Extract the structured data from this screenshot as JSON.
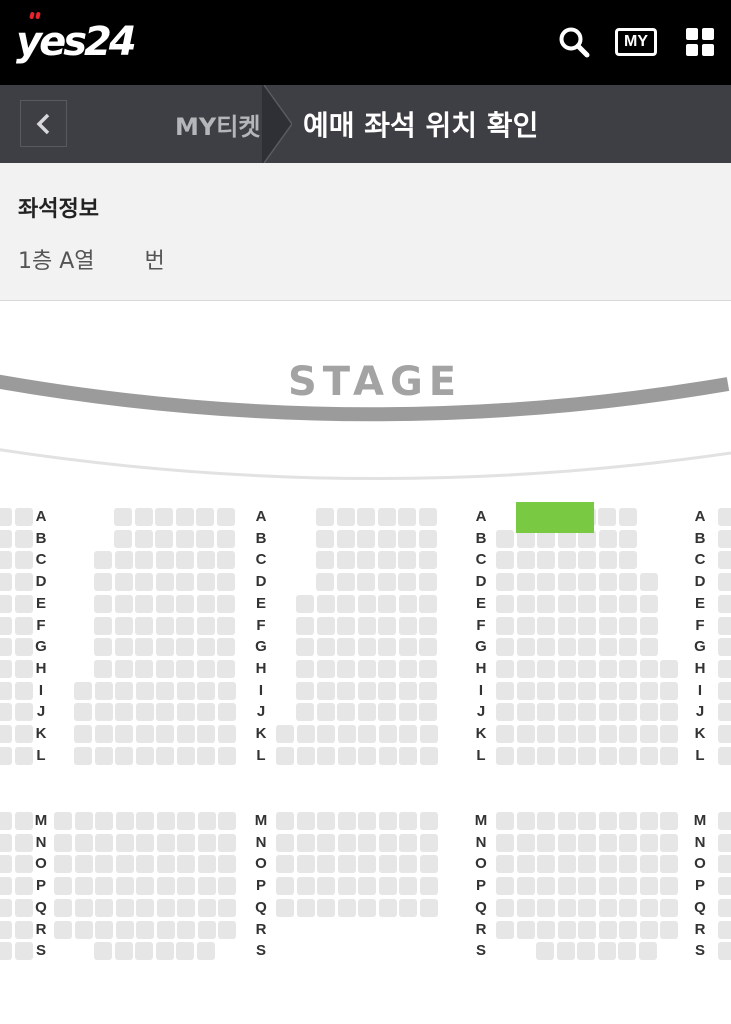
{
  "header": {
    "logo_text": "yes24",
    "my_button_label": "MY",
    "icons": [
      "search-icon",
      "my-ticket-icon",
      "grid-menu-icon"
    ],
    "colors": {
      "background": "#000000",
      "logo_dots": "#e8232b"
    }
  },
  "breadcrumb": {
    "parent": "MY티켓",
    "current": "예매 좌석 위치 확인",
    "back_icon": "chevron-left-icon"
  },
  "seat_info": {
    "title": "좌석정보",
    "floor_row": "1층 A열",
    "seat_suffix": "번"
  },
  "seatmap": {
    "stage_label": "STAGE",
    "block_row_labels": [
      "A",
      "B",
      "C",
      "D",
      "E",
      "F",
      "G",
      "H",
      "I",
      "J",
      "K",
      "L",
      "M",
      "N",
      "O",
      "P",
      "Q",
      "R",
      "S"
    ],
    "highlight_color": "#7ac943",
    "seat_color": "#e6e6e6"
  }
}
